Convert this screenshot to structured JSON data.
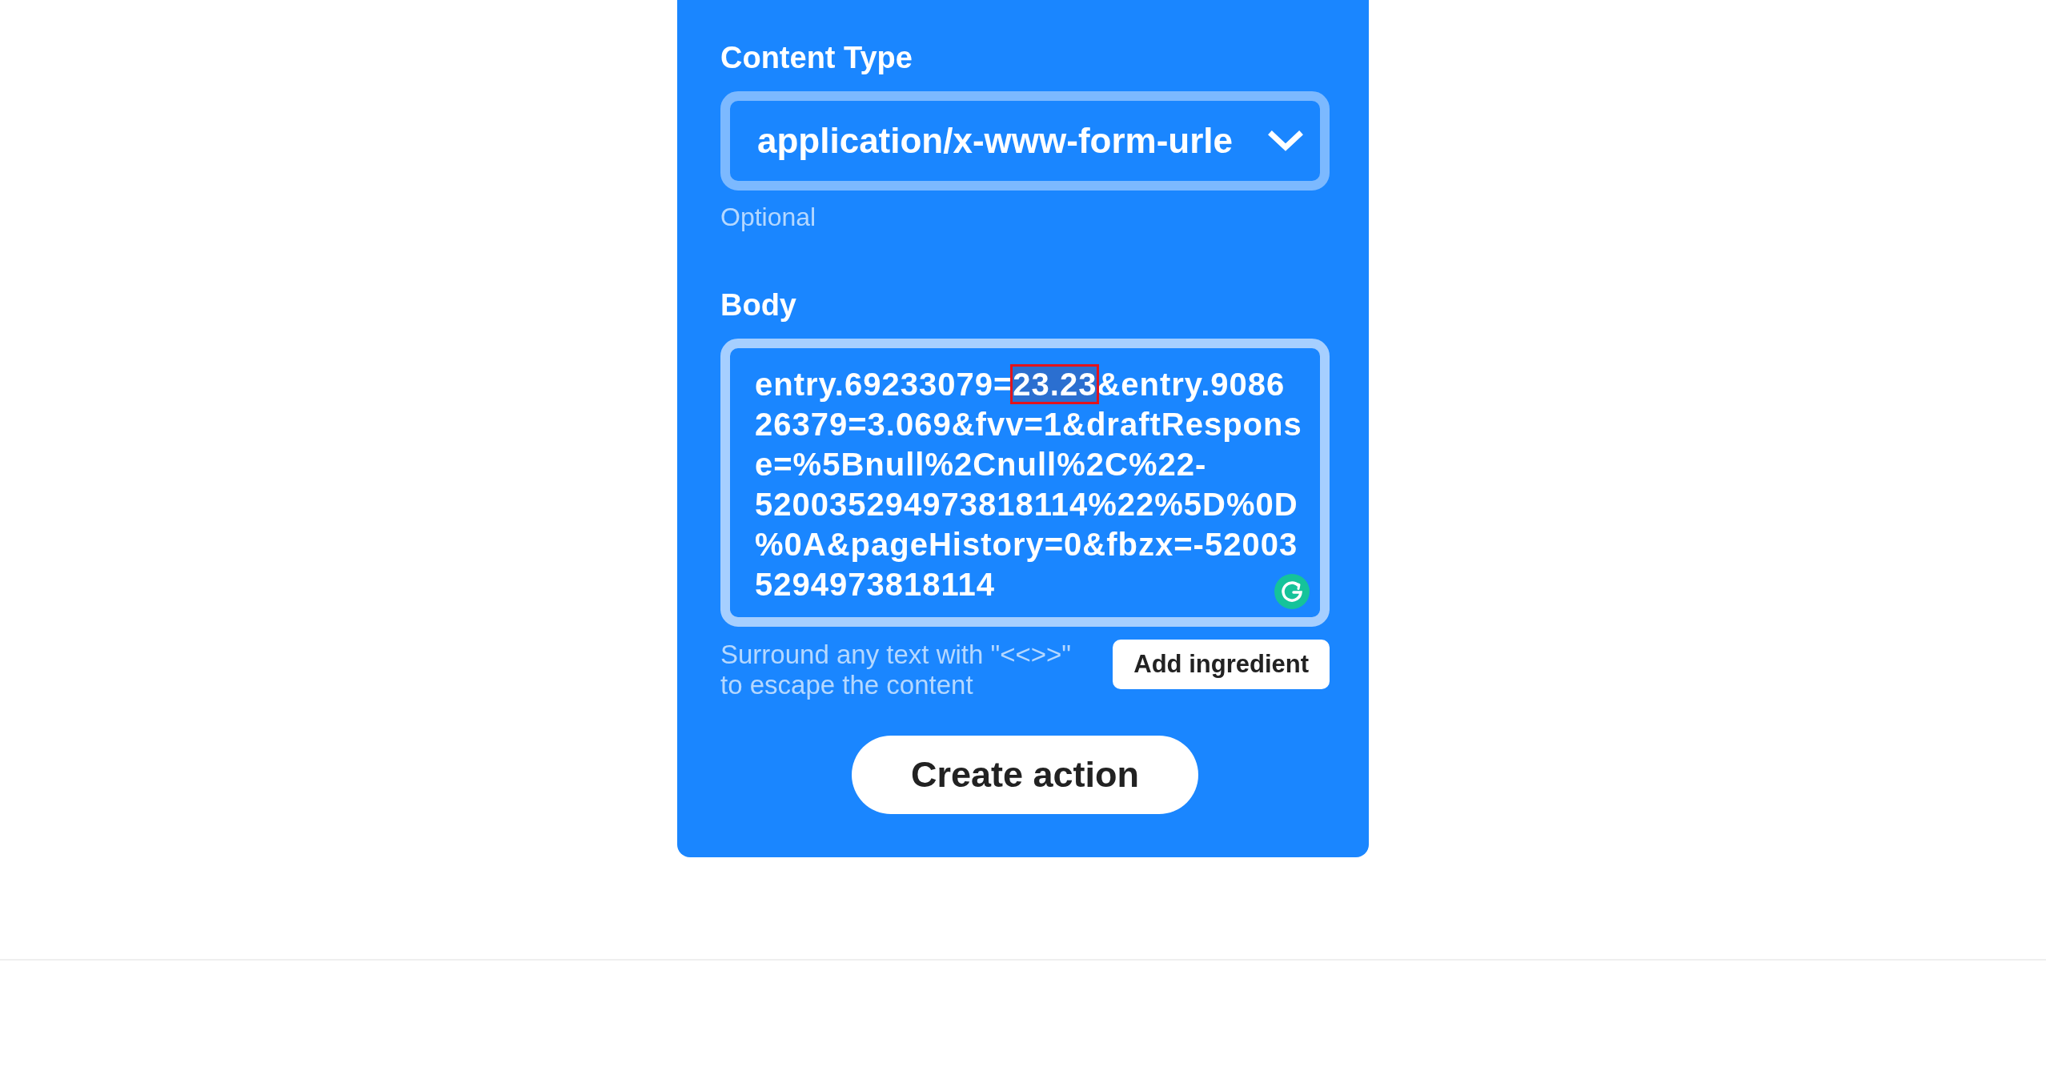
{
  "content_type": {
    "label": "Content Type",
    "value": "application/x-www-form-urle",
    "help_text": "Optional"
  },
  "body": {
    "label": "Body",
    "segments": [
      {
        "text": "entry.69233079=",
        "selected": false
      },
      {
        "text": "23.23",
        "selected": true
      },
      {
        "text": "&entry.908626379=3.069&fvv=1&draftResponse=%5Bnull%2Cnull%2C%22-520035294973818114%22%5D%0D%0A&pageHistory=0&fbzx=-520035294973818114",
        "selected": false
      }
    ],
    "help_text": "Surround any text with \"<<>>\" to escape the content",
    "add_button": "Add ingredient"
  },
  "primary_button": "Create action"
}
